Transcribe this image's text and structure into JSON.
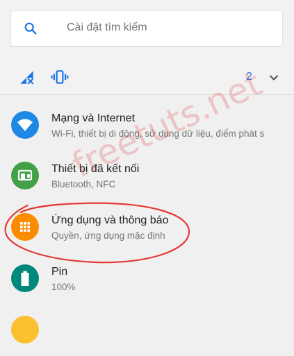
{
  "search": {
    "placeholder": "Cài đặt tìm kiếm",
    "icon": "search-icon"
  },
  "quick_settings": {
    "icons": [
      "no-signal-icon",
      "vibrate-icon"
    ],
    "count": "2",
    "chevron": "chevron-down-icon",
    "accent_color": "#1a73e8"
  },
  "settings_list": [
    {
      "title": "Mạng và Internet",
      "summary": "Wi-Fi, thiết bị di động, sử dụng dữ liệu, điểm phát s",
      "icon": "wifi-icon",
      "color": "#1e88e5"
    },
    {
      "title": "Thiết bị đã kết nối",
      "summary": "Bluetooth, NFC",
      "icon": "connected-devices-icon",
      "color": "#43a047"
    },
    {
      "title": "Ứng dụng và thông báo",
      "summary": "Quyền, ứng dụng mặc định",
      "icon": "apps-icon",
      "color": "#fb8c00"
    },
    {
      "title": "Pin",
      "summary": "100%",
      "icon": "battery-icon",
      "color": "#00897b"
    }
  ],
  "watermark": {
    "text": "freetuts.net"
  },
  "annotation_color": "#e53935"
}
